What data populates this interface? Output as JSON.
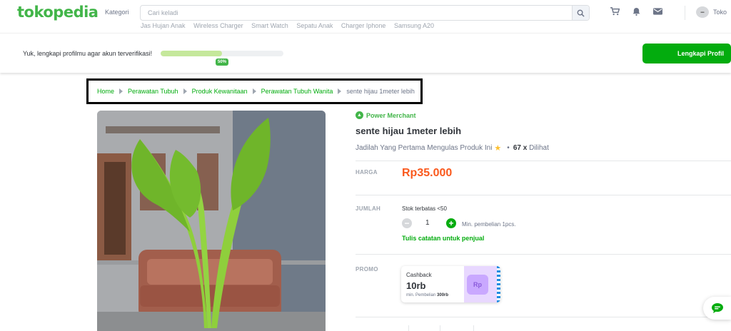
{
  "header": {
    "logo": "tokopedia",
    "kategori": "Kategori",
    "search_placeholder": "Cari keladi",
    "trending": [
      "Jas Hujan Anak",
      "Wireless Charger",
      "Smart Watch",
      "Sepatu Anak",
      "Charger Iphone",
      "Samsung A20"
    ],
    "toko_label": "Toko"
  },
  "profile_prompt": {
    "text": "Yuk, lengkapi profilmu agar akun terverifikasi!",
    "progress_percent": 50,
    "progress_label": "50%",
    "button_label": "Lengkapi Profil"
  },
  "breadcrumb": {
    "links": [
      "Home",
      "Perawatan Tubuh",
      "Produk Kewanitaan",
      "Perawatan Tubuh Wanita"
    ],
    "current": "sente hijau 1meter lebih"
  },
  "product": {
    "merchant_badge": "Power Merchant",
    "title": "sente hijau 1meter lebih",
    "review_prompt": "Jadilah Yang Pertama Mengulas Produk Ini",
    "views": "67 x",
    "views_suffix": "Dilihat",
    "price_label": "HARGA",
    "price": "Rp35.000",
    "qty_label": "JUMLAH",
    "stock_text": "Stok terbatas <50",
    "quantity": "1",
    "min_purchase": "Min. pembelian 1pcs.",
    "note_link": "Tulis catatan untuk penjual",
    "promo_label": "PROMO"
  },
  "promo": {
    "kicker": "Cashback",
    "amount": "10rb",
    "min_prefix": "min. Pembelian",
    "min_value": "300rb",
    "art_label": "Rp"
  },
  "colors": {
    "brand_green": "#03ac0e",
    "price_orange": "#fa591d"
  }
}
